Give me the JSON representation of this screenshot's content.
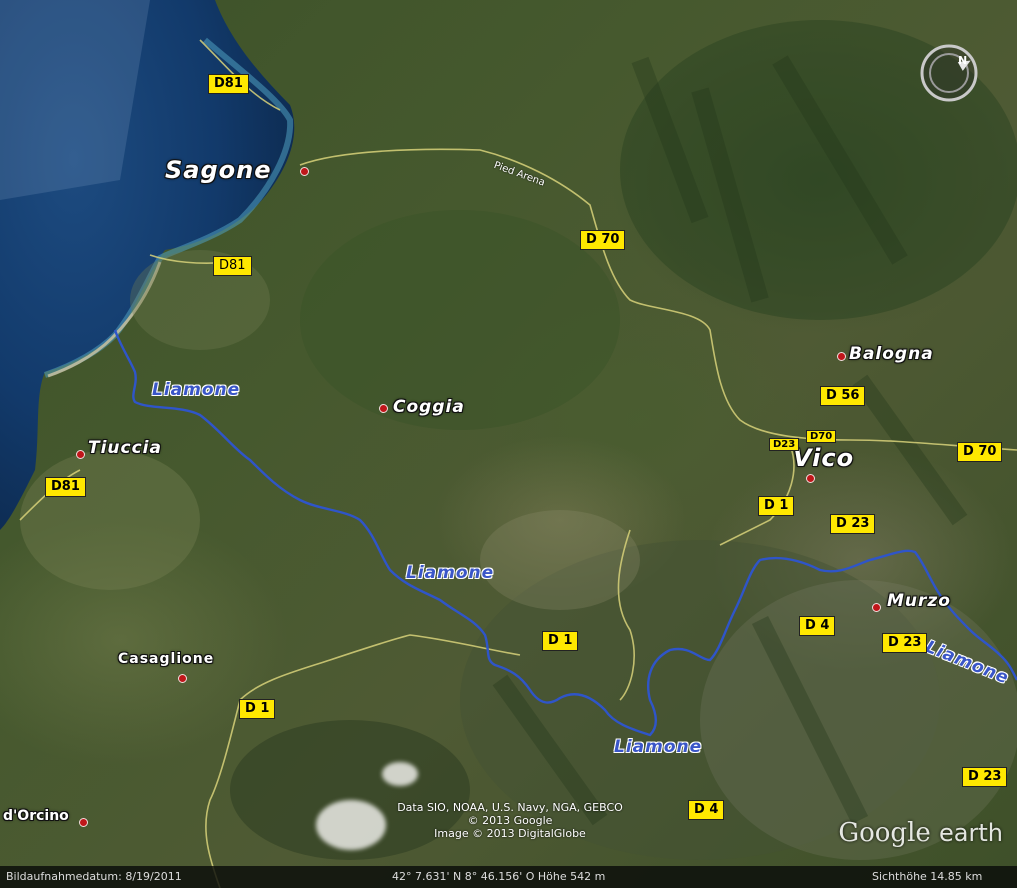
{
  "places": {
    "sagone": "Sagone",
    "tiuccia": "Tiuccia",
    "coggia": "Coggia",
    "balogna": "Balogna",
    "vico": "Vico",
    "murzo": "Murzo",
    "casaglione": "Casaglione",
    "orcino": "d'Orcino",
    "pied_arena": "Pied Arena"
  },
  "rivers": {
    "r1": "Liamone",
    "r2": "Liamone",
    "r3": "Liamone",
    "r4": "Liamone"
  },
  "roads": {
    "d81_top": "D81",
    "d81_mid": "D81",
    "d81_left": "D81",
    "d70_top": "D 70",
    "d70_right": "D 70",
    "d70_small": "D70",
    "d23_small": "D23",
    "d56": "D 56",
    "d1_vico": "D 1",
    "d23_vico": "D 23",
    "d4_mid": "D 4",
    "d23_murzo": "D 23",
    "d1_center": "D 1",
    "d1_left": "D 1",
    "d23_bottom": "D 23",
    "d4_bottom": "D 4"
  },
  "attribution": {
    "line1": "Data SIO, NOAA, U.S. Navy, NGA, GEBCO",
    "line2": "© 2013 Google",
    "line3": "Image © 2013 DigitalGlobe"
  },
  "logo": {
    "google": "Google",
    "earth": "earth"
  },
  "status_bar": {
    "date": "Bildaufnahmedatum: 8/19/2011",
    "coords": "42° 7.631' N   8° 46.156' O  Höhe   542 m",
    "eye_alt": "Sichthöhe   14.85 km"
  },
  "compass": {
    "north": "N"
  },
  "colors": {
    "river": "#2f55c9",
    "road_line": "#d8d27a",
    "road_badge": "#ffe800",
    "sea": "#123a6b"
  }
}
